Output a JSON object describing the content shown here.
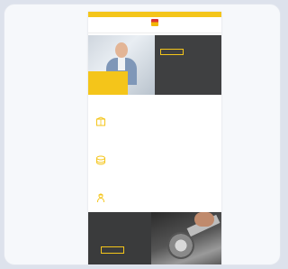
{
  "topbar": {
    "left_text": "",
    "right_text": ""
  },
  "logo": {
    "text": ""
  },
  "nav": {
    "items": [
      "",
      "",
      "",
      "",
      "",
      ""
    ]
  },
  "hero": {
    "title": "",
    "subtitle": "",
    "button_label": "",
    "yellow_text": ""
  },
  "features": [
    {
      "icon": "box-icon",
      "title": "",
      "text": ""
    },
    {
      "icon": "coins-icon",
      "title": "",
      "text": ""
    },
    {
      "icon": "worker-icon",
      "title": "",
      "text": ""
    }
  ],
  "bottom": {
    "title": "",
    "button_label": ""
  },
  "colors": {
    "accent_yellow": "#f4c51a",
    "dark_panel": "#3f4041",
    "brand_red": "#d33333"
  }
}
